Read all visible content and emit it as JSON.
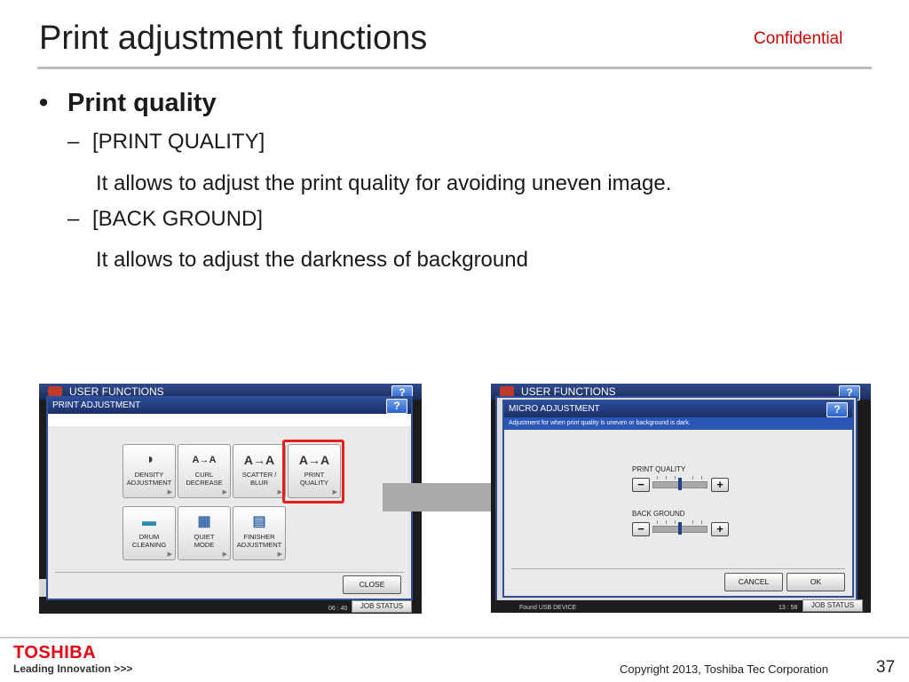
{
  "header": {
    "title": "Print adjustment functions",
    "confidential": "Confidential"
  },
  "body": {
    "main_bullet": "Print quality",
    "bullet_symbol": "•",
    "dash_symbol": "–",
    "items": [
      {
        "label": "[PRINT QUALITY]",
        "desc": "It allows to adjust the print quality for avoiding uneven image."
      },
      {
        "label": "[BACK GROUND]",
        "desc": "It allows to adjust the darkness of background"
      }
    ]
  },
  "screen_left": {
    "top_title": "USER FUNCTIONS",
    "help": "?",
    "window_title": "PRINT ADJUSTMENT",
    "tiles": [
      {
        "icon": "◑",
        "line1": "DENSITY",
        "line2": "ADJUSTMENT"
      },
      {
        "icon": "A→A",
        "line1": "CURL",
        "line2": "DECREASE"
      },
      {
        "icon": "A→A",
        "line1": "SCATTER /",
        "line2": "BLUR"
      },
      {
        "icon": "A→A",
        "line1": "PRINT",
        "line2": "QUALITY"
      },
      {
        "icon": "▬",
        "line1": "DRUM",
        "line2": "CLEANING"
      },
      {
        "icon": "▦",
        "line1": "QUIET",
        "line2": "MODE"
      },
      {
        "icon": "▤",
        "line1": "FINISHER",
        "line2": "ADJUSTMENT"
      }
    ],
    "close": "CLOSE",
    "clock": "06 : 40",
    "job_status": "JOB STATUS"
  },
  "screen_right": {
    "top_title": "USER FUNCTIONS",
    "help": "?",
    "window_title": "MICRO ADJUSTMENT",
    "subtitle": "Adjustment for when print quality is uneven or background is dark.",
    "print_quality": {
      "label": "PRINT QUALITY",
      "minus": "−",
      "plus": "+",
      "level": 0.5
    },
    "back_ground": {
      "label": "BACK GROUND",
      "minus": "−",
      "plus": "+",
      "level": 0.5
    },
    "cancel": "CANCEL",
    "ok": "OK",
    "status_text": "Found USB DEVICE",
    "clock": "13 : 58",
    "job_status": "JOB STATUS"
  },
  "footer": {
    "logo": "TOSHIBA",
    "tagline": "Leading Innovation >>>",
    "copyright": "Copyright 2013, Toshiba Tec Corporation",
    "page": "37"
  },
  "colors": {
    "accent_red": "#cc0000",
    "highlight_red": "#e61e1e",
    "screen_blue": "#2d4f9c"
  }
}
